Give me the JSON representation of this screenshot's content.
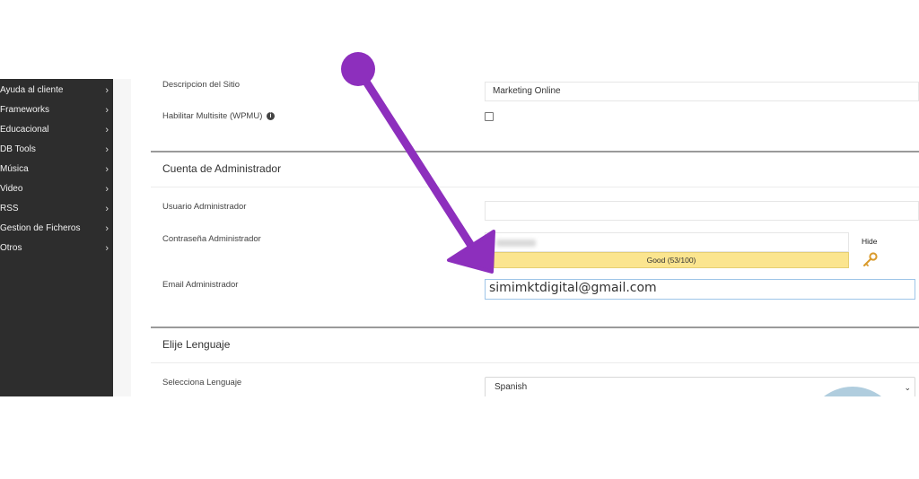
{
  "sidebar": {
    "items": [
      {
        "label": "Ayuda al cliente"
      },
      {
        "label": "Frameworks"
      },
      {
        "label": " Educacional"
      },
      {
        "label": "DB Tools"
      },
      {
        "label": "Música"
      },
      {
        "label": "Video"
      },
      {
        "label": "RSS"
      },
      {
        "label": "Gestion de Ficheros"
      },
      {
        "label": "Otros"
      }
    ],
    "chevron": "›"
  },
  "site": {
    "description_label": "Descripcion del Sitio",
    "description_value": "Marketing Online",
    "multisite_label": "Habilitar Multisite (WPMU)",
    "multisite_checked": false
  },
  "admin": {
    "section_title": "Cuenta de Administrador",
    "user_label": "Usuario Administrador",
    "password_label": "Contraseña Administrador",
    "password_strength": "Good (53/100)",
    "password_strength_percent": 53,
    "hide_label": "Hide",
    "email_label": "Email Administrador",
    "email_value": "simimktdigital@gmail.com"
  },
  "language": {
    "section_title": "Elije Lenguaje",
    "select_label": "Selecciona Lenguaje",
    "selected": "Spanish"
  },
  "annotation": {
    "arrow_color": "#8d2fbd"
  },
  "colors": {
    "sidebar_bg": "#2d2d2d",
    "strength_bar": "#fbe58f",
    "email_border": "#9ec5e8"
  }
}
